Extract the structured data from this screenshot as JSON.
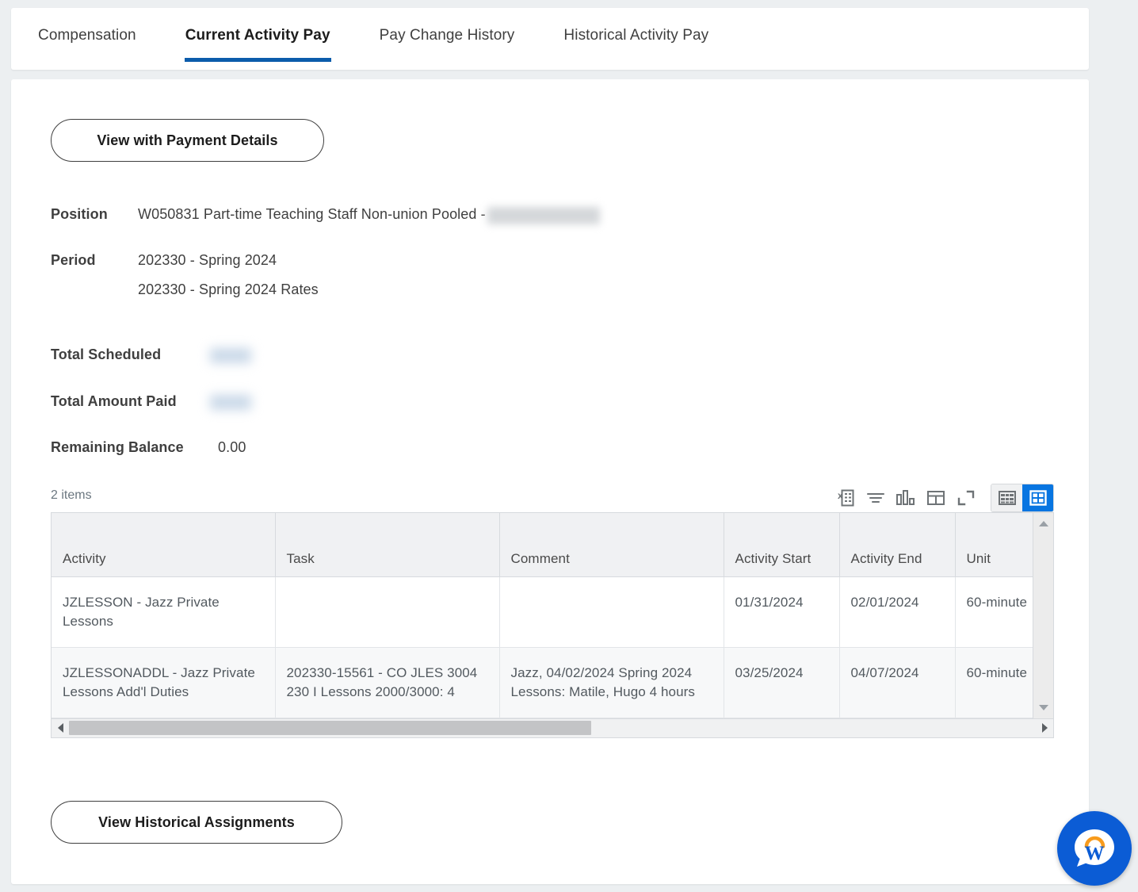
{
  "tabs": [
    {
      "label": "Compensation",
      "active": false
    },
    {
      "label": "Current Activity Pay",
      "active": true
    },
    {
      "label": "Pay Change History",
      "active": false
    },
    {
      "label": "Historical Activity Pay",
      "active": false
    }
  ],
  "buttons": {
    "view_with_payment_details": "View with Payment Details",
    "view_historical_assignments": "View Historical Assignments"
  },
  "details": {
    "position_label": "Position",
    "position_value": "W050831 Part-time Teaching Staff Non-union Pooled -",
    "position_redacted": true,
    "period_label": "Period",
    "period_values": [
      "202330 - Spring 2024",
      "202330 - Spring 2024 Rates"
    ],
    "total_scheduled_label": "Total Scheduled",
    "total_scheduled_value": "",
    "total_scheduled_redacted": true,
    "total_amount_paid_label": "Total Amount Paid",
    "total_amount_paid_value": "",
    "total_amount_paid_redacted": true,
    "remaining_balance_label": "Remaining Balance",
    "remaining_balance_value": "0.00"
  },
  "grid": {
    "items_count": "2 items",
    "tools": [
      {
        "name": "export-to-excel-icon",
        "title": "Export to Excel"
      },
      {
        "name": "filter-icon",
        "title": "Filter"
      },
      {
        "name": "chart-icon",
        "title": "Chart View"
      },
      {
        "name": "toggle-details-icon",
        "title": "Toggle Details"
      },
      {
        "name": "expand-icon",
        "title": "Expand"
      }
    ],
    "view_toggle": [
      {
        "name": "list-view-icon",
        "active": false
      },
      {
        "name": "grid-view-icon",
        "active": true
      }
    ],
    "columns": [
      "Activity",
      "Task",
      "Comment",
      "Activity Start",
      "Activity End",
      "Unit"
    ],
    "rows": [
      {
        "activity": "JZLESSON - Jazz Private Lessons",
        "task": "",
        "comment": "",
        "activity_start": "01/31/2024",
        "activity_end": "02/01/2024",
        "unit": "60-minute"
      },
      {
        "activity": "JZLESSONADDL - Jazz Private Lessons Add'l Duties",
        "task": "202330-15561 - CO JLES 3004 230 I Lessons 2000/3000: 4",
        "comment": "Jazz, 04/02/2024 Spring 2024 Lessons: Matile, Hugo 4 hours",
        "activity_start": "03/25/2024",
        "activity_end": "04/07/2024",
        "unit": "60-minute"
      }
    ]
  },
  "assistant": {
    "name": "workday-assistant",
    "letter": "W"
  },
  "colors": {
    "accent_blue": "#0b5cab",
    "active_toggle_blue": "#0875e1",
    "assistant_blue": "#0b5cd5",
    "assistant_arc_orange": "#f89b1c",
    "page_background": "#eceff1",
    "card_background": "#ffffff",
    "header_row": "#f0f1f3",
    "alt_row": "#f7f8f9"
  }
}
